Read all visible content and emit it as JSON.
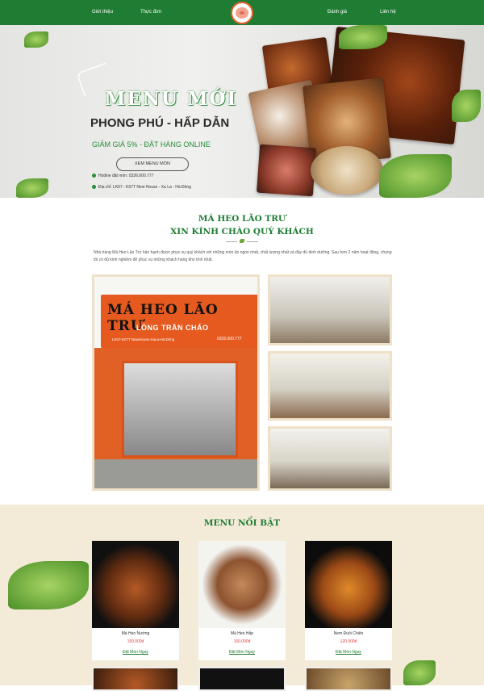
{
  "nav": {
    "items": [
      "Giới thiệu",
      "Thực đơn",
      "Đánh giá",
      "Liên hệ"
    ]
  },
  "hero": {
    "title": "MENU MỚI",
    "subtitle": "PHONG PHÚ - HẤP DẪN",
    "discount": "GIẢM GIÁ 5% - ĐẶT HÀNG ONLINE",
    "button": "XEM MENU MÓN",
    "hotline": "Hotline đặt món: 0326.000.777",
    "address": "Địa chỉ: LK07 - K07T New House - Xa La - Hà Đông"
  },
  "intro": {
    "title1": "MÁ HEO LÃO TRƯ",
    "title2": "XIN KÍNH CHÀO QUÝ KHÁCH",
    "text": "Nhà hàng Má Heo Lão Trư hân hạnh được phục vụ quý khách với những món ăn ngon nhất, chất lượng nhất và đầy đủ dinh dưỡng. Sau hơn 2 năm hoạt động, chúng tôi có đủ kinh nghiệm để phục vụ những khách hàng khó tính nhất.",
    "sign": {
      "name": "MÁ HEO LÃO TRƯ",
      "sub": "LÒNG TRẦN CHÁO",
      "address": "LK07-K07T NewHouse-XaLa-Hà Đông",
      "phone": "0326.000.777"
    }
  },
  "menu": {
    "title": "MENU NỔI BẬT",
    "items": [
      {
        "name": "Má Heo Nướng",
        "price": "150.000đ",
        "order": "Đặt Món Ngay"
      },
      {
        "name": "Má Heo Hấp",
        "price": "150.000đ",
        "order": "Đặt Món Ngay"
      },
      {
        "name": "Nem Đuôi Chiên",
        "price": "120.000đ",
        "order": "Đặt Món Ngay"
      }
    ]
  }
}
